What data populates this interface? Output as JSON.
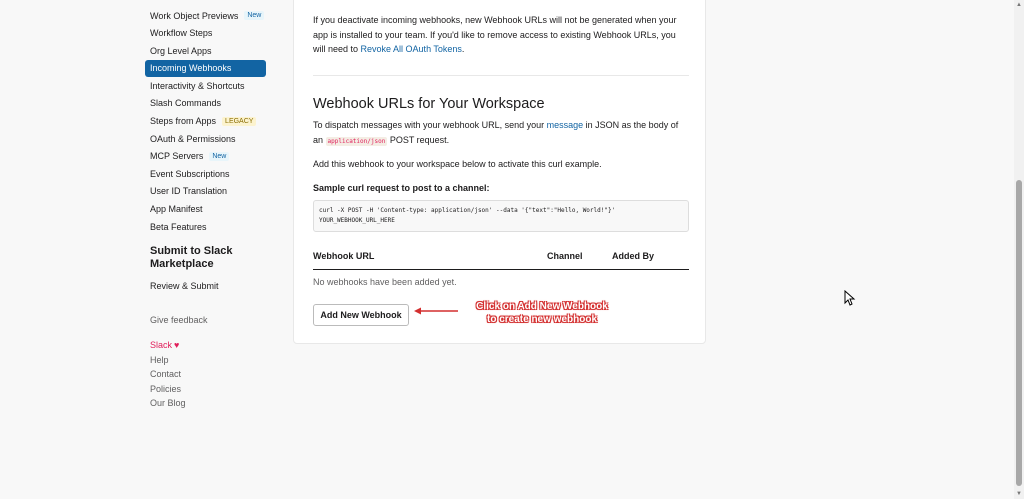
{
  "sidebar": {
    "items": [
      {
        "label": "Work Object Previews",
        "badge": "New"
      },
      {
        "label": "Workflow Steps"
      },
      {
        "label": "Org Level Apps"
      },
      {
        "label": "Incoming Webhooks"
      },
      {
        "label": "Interactivity & Shortcuts"
      },
      {
        "label": "Slash Commands"
      },
      {
        "label": "Steps from Apps",
        "badge": "LEGACY"
      },
      {
        "label": "OAuth & Permissions"
      },
      {
        "label": "MCP Servers",
        "badge": "New"
      },
      {
        "label": "Event Subscriptions"
      },
      {
        "label": "User ID Translation"
      },
      {
        "label": "App Manifest"
      },
      {
        "label": "Beta Features"
      }
    ],
    "marketplace_heading": "Submit to Slack Marketplace",
    "review_submit": "Review & Submit",
    "give_feedback": "Give feedback",
    "footer": {
      "slack": "Slack",
      "help": "Help",
      "contact": "Contact",
      "policies": "Policies",
      "blog": "Our Blog"
    }
  },
  "main": {
    "deactivate_text_1": "If you deactivate incoming webhooks, new Webhook URLs will not be generated when your app is installed to your team. If you'd like to remove access to existing Webhook URLs, you will need to ",
    "revoke_link": "Revoke All OAuth Tokens",
    "deactivate_text_end": ".",
    "section_title": "Webhook URLs for Your Workspace",
    "dispatch_text_1": "To dispatch messages with your webhook URL, send your ",
    "message_link": "message",
    "dispatch_text_2": " in JSON as the body of an ",
    "content_type_code": "application/json",
    "dispatch_text_3": " POST request.",
    "add_text": "Add this webhook to your workspace below to activate this curl example.",
    "sample_label": "Sample curl request to post to a channel:",
    "curl_line_1": "curl -X POST -H 'Content-type: application/json' --data '{\"text\":\"Hello, World!\"}'",
    "curl_line_2": "YOUR_WEBHOOK_URL_HERE",
    "table": {
      "col_url": "Webhook URL",
      "col_channel": "Channel",
      "col_added_by": "Added By",
      "empty": "No webhooks have been added yet."
    },
    "add_button": "Add New Webhook"
  },
  "annotation": {
    "line_1": "Click on Add New Webhook",
    "line_2": "to create new webhook"
  },
  "colors": {
    "accent": "#1264a3",
    "annotation": "#d32f2f",
    "brand_pink": "#e01e5a"
  }
}
